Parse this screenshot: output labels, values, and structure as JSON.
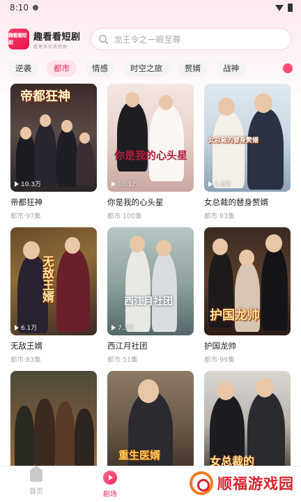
{
  "status_bar": {
    "time": "8:10"
  },
  "header": {
    "logo_text": "趣看看短剧",
    "app_name": "趣看看短剧",
    "tagline": "看更多优质短剧",
    "search_placeholder": "龙王令之一眼至尊"
  },
  "categories": [
    {
      "label": "逆袭",
      "active": false
    },
    {
      "label": "都市",
      "active": true
    },
    {
      "label": "情感",
      "active": false
    },
    {
      "label": "时空之旅",
      "active": false
    },
    {
      "label": "赘婿",
      "active": false
    },
    {
      "label": "战神",
      "active": false
    }
  ],
  "cards": [
    {
      "title": "帝都狂神",
      "genre": "都市",
      "episodes": "97集",
      "plays": "10.3万",
      "poster_text": "帝都狂神"
    },
    {
      "title": "你是我的心头星",
      "genre": "都市",
      "episodes": "100集",
      "plays": "10.1万",
      "poster_text": "你是我的心头星"
    },
    {
      "title": "女总裁的替身赘婿",
      "genre": "都市",
      "episodes": "83集",
      "plays": "1.6万",
      "poster_text": "女总裁的替身赘婿"
    },
    {
      "title": "无敌王婿",
      "genre": "都市",
      "episodes": "83集",
      "plays": "6.1万",
      "poster_text": "无敌王婿"
    },
    {
      "title": "西江月社团",
      "genre": "都市",
      "episodes": "51集",
      "plays": "7.3万",
      "poster_text": "西江月社团"
    },
    {
      "title": "护国龙帅",
      "genre": "都市",
      "episodes": "99集",
      "plays": "",
      "poster_text": "护国龙帅"
    },
    {
      "title": "",
      "genre": "",
      "episodes": "",
      "plays": "",
      "poster_text": ""
    },
    {
      "title": "",
      "genre": "",
      "episodes": "",
      "plays": "",
      "poster_text": "重生医婿"
    },
    {
      "title": "",
      "genre": "",
      "episodes": "",
      "plays": "",
      "poster_text": "女总裁的"
    }
  ],
  "bottom_nav": {
    "home_label": "首页",
    "drama_label": "剧场"
  },
  "watermark": {
    "text": "顺福游戏园"
  },
  "colors": {
    "accent": "#ee2b5f",
    "accent_bg": "#ffe2ea"
  }
}
